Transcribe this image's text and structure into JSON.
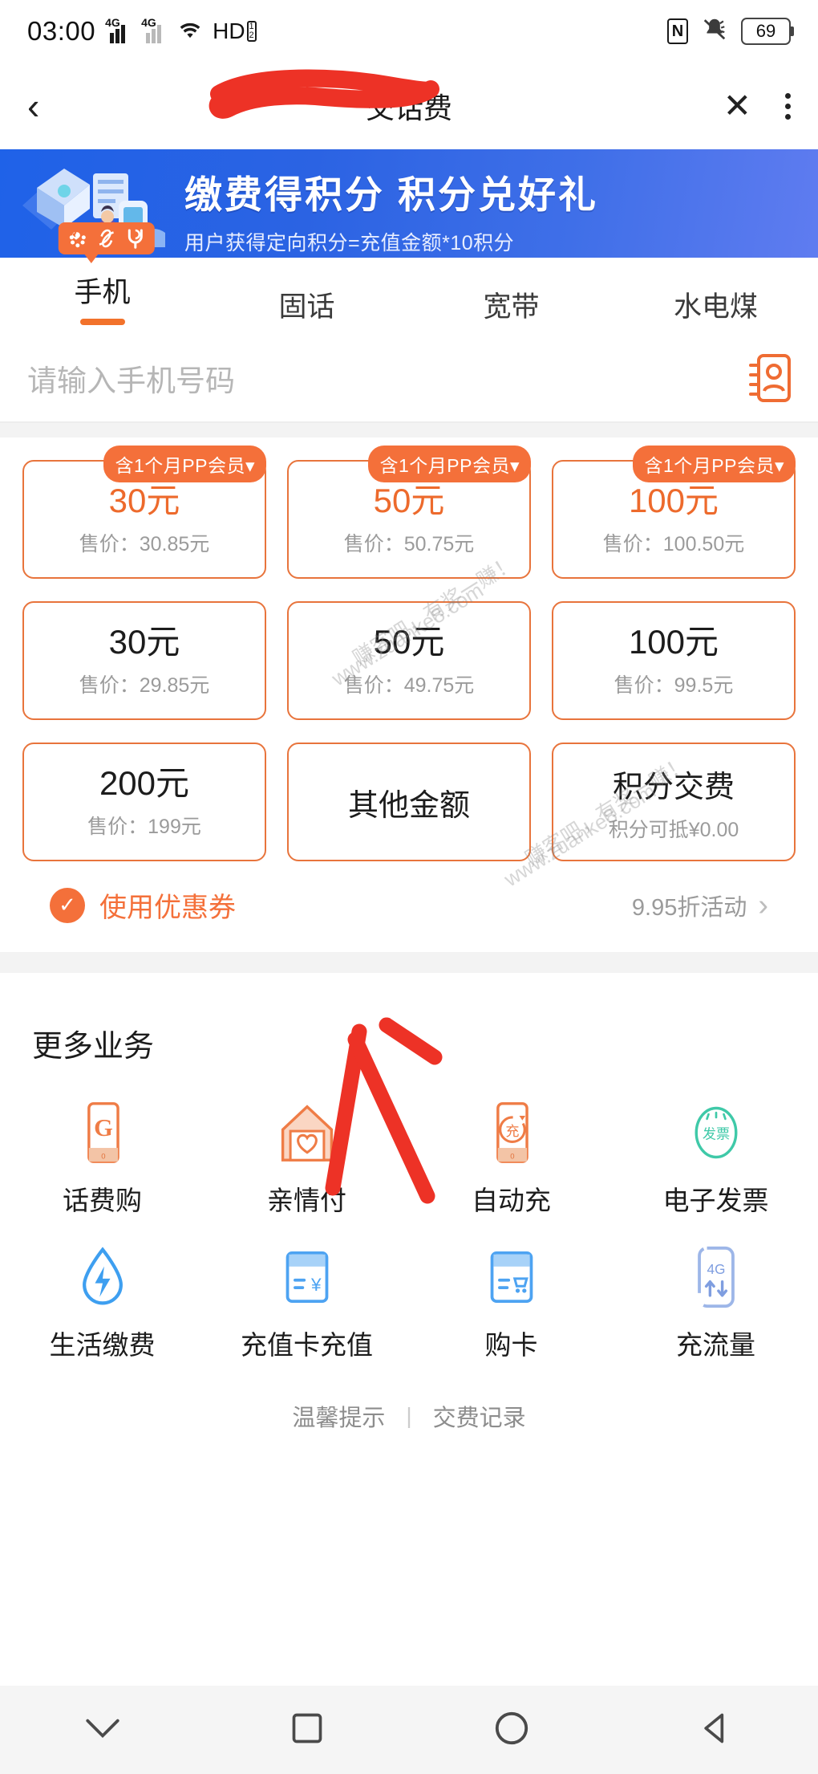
{
  "statusbar": {
    "time": "03:00",
    "net1": "4G",
    "net2": "4G",
    "wifi_icon": "wifi-icon",
    "hd_label": "HD",
    "hd_sub_top": "1",
    "hd_sub_bottom": "2",
    "nfc_label": "N",
    "mute_icon": "bell-muted-icon",
    "battery": "69"
  },
  "appbar": {
    "back_icon": "chevron-left-icon",
    "title": "交话费",
    "close_icon": "close-icon",
    "menu_icon": "more-vertical-icon"
  },
  "banner": {
    "main": "缴费得积分  积分兑好礼",
    "sub": "用户获得定向积分=充值金额*10积分"
  },
  "tabs": {
    "badge_icons": [
      "china-unicom-icon",
      "china-mobile-icon",
      "china-telecom-icon"
    ],
    "items": [
      {
        "label": "手机",
        "active": true
      },
      {
        "label": "固话",
        "active": false
      },
      {
        "label": "宽带",
        "active": false
      },
      {
        "label": "水电煤",
        "active": false
      }
    ]
  },
  "phone_input": {
    "value": "",
    "placeholder": "请输入手机号码",
    "contacts_icon": "contacts-icon"
  },
  "amounts": [
    {
      "amount": "30元",
      "price": "售价：30.85元",
      "ribbon": "含1个月PP会员▾",
      "promo": true
    },
    {
      "amount": "50元",
      "price": "售价：50.75元",
      "ribbon": "含1个月PP会员▾",
      "promo": true
    },
    {
      "amount": "100元",
      "price": "售价：100.50元",
      "ribbon": "含1个月PP会员▾",
      "promo": true
    },
    {
      "amount": "30元",
      "price": "售价：29.85元",
      "ribbon": "",
      "promo": false
    },
    {
      "amount": "50元",
      "price": "售价：49.75元",
      "ribbon": "",
      "promo": false
    },
    {
      "amount": "100元",
      "price": "售价：99.5元",
      "ribbon": "",
      "promo": false
    },
    {
      "amount": "200元",
      "price": "售价：199元",
      "ribbon": "",
      "promo": false
    },
    {
      "amount": "其他金额",
      "price": "",
      "ribbon": "",
      "promo": false
    },
    {
      "amount": "积分交费",
      "price": "积分可抵¥0.00",
      "ribbon": "",
      "promo": false
    }
  ],
  "coupon": {
    "check_icon": "check-circle-icon",
    "label": "使用优惠券",
    "activity": "9.95折活动",
    "chevron_icon": "chevron-right-icon"
  },
  "more": {
    "title": "更多业务",
    "services": [
      {
        "label": "话费购",
        "icon": "phone-coin-icon"
      },
      {
        "label": "亲情付",
        "icon": "house-heart-icon"
      },
      {
        "label": "自动充",
        "icon": "phone-autorecharge-icon"
      },
      {
        "label": "电子发票",
        "icon": "e-invoice-icon"
      },
      {
        "label": "生活缴费",
        "icon": "water-drop-bolt-icon"
      },
      {
        "label": "充值卡充值",
        "icon": "card-yuan-icon"
      },
      {
        "label": "购卡",
        "icon": "card-cart-icon"
      },
      {
        "label": "充流量",
        "icon": "phone-4g-icon"
      }
    ]
  },
  "footer": {
    "tips": "温馨提示",
    "separator": "|",
    "records": "交费记录"
  },
  "navbar": {
    "recent_icon": "chevron-down-icon",
    "square_icon": "square-icon",
    "home_icon": "circle-icon",
    "back_icon": "triangle-back-icon"
  },
  "watermarks": [
    "赚客吧，有奖一赚！",
    "www.zuanke8.com"
  ],
  "colors": {
    "accent_orange": "#f4703a",
    "banner_blue": "#2b63e3",
    "annotation_red": "#ed3226",
    "muted_text": "#9b9b9b"
  }
}
